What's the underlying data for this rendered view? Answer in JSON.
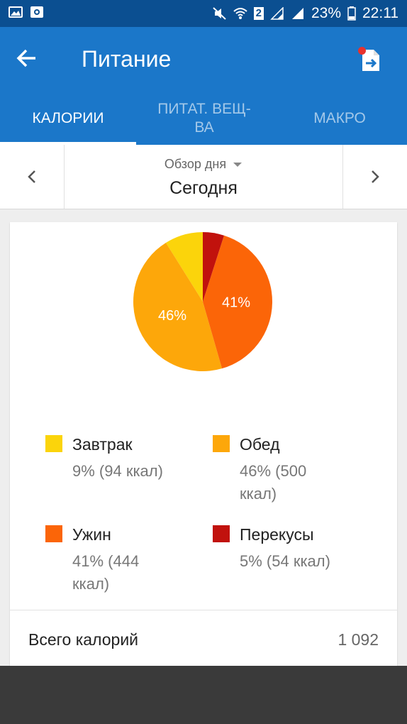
{
  "status_bar": {
    "sim_badge": "2",
    "battery": "23%",
    "time": "22:11",
    "icons": [
      "gallery-icon",
      "camera-icon",
      "mute-icon",
      "wifi-icon",
      "signal-icon",
      "battery-icon"
    ]
  },
  "app_bar": {
    "title": "Питание",
    "back_icon": "arrow-left-icon",
    "export_icon": "file-export-icon"
  },
  "tabs": [
    {
      "label": "КАЛОРИИ",
      "active": true
    },
    {
      "label": "ПИТАТ. ВЕЩ-\nВА",
      "active": false
    },
    {
      "label": "МАКРО",
      "active": false
    }
  ],
  "day_selector": {
    "subtitle": "Обзор дня",
    "day": "Сегодня"
  },
  "chart_data": {
    "type": "pie",
    "slices": [
      {
        "name": "Завтрак",
        "percent": 9,
        "kcal": 94,
        "color": "#fbd40b",
        "label": ""
      },
      {
        "name": "Обед",
        "percent": 46,
        "kcal": 500,
        "color": "#fda70a",
        "label": "46%"
      },
      {
        "name": "Ужин",
        "percent": 41,
        "kcal": 444,
        "color": "#fb6508",
        "label": "41%"
      },
      {
        "name": "Перекусы",
        "percent": 5,
        "kcal": 54,
        "color": "#c1120d",
        "label": ""
      }
    ]
  },
  "legend": [
    {
      "name": "Завтрак",
      "value": "9% (94 ккал)",
      "color": "#fbd40b"
    },
    {
      "name": "Обед",
      "value": "46% (500 ккал)",
      "color": "#fda70a"
    },
    {
      "name": "Ужин",
      "value": "41% (444 ккал)",
      "color": "#fb6508"
    },
    {
      "name": "Перекусы",
      "value": "5% (54 ккал)",
      "color": "#c1120d"
    }
  ],
  "total": {
    "label": "Всего калорий",
    "value": "1 092"
  }
}
